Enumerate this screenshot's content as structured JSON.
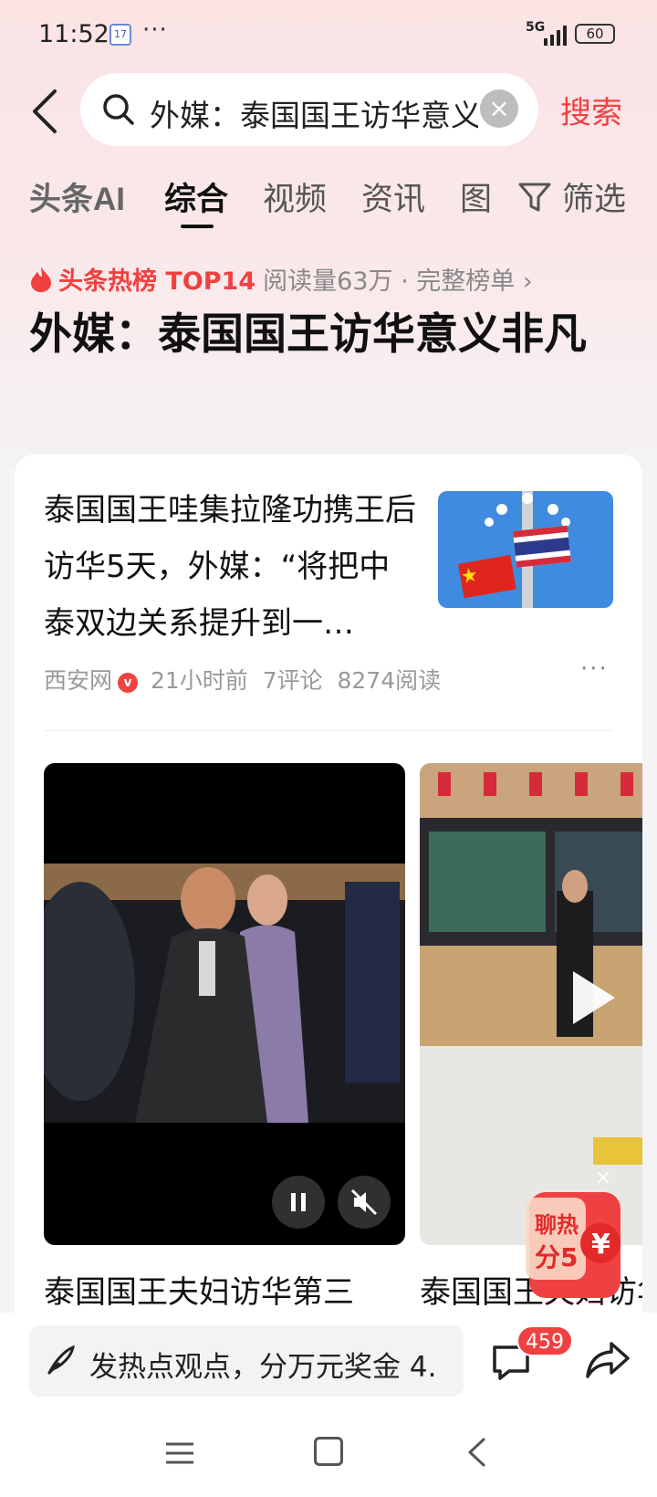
{
  "status_bar": {
    "time": "11:52",
    "cal_day": "17",
    "dots": "···",
    "network": "5G",
    "battery": "60"
  },
  "search": {
    "query": "外媒：泰国国王访华意义非凡",
    "clear_glyph": "×",
    "button": "搜索"
  },
  "tabs": [
    {
      "label": "头条AI"
    },
    {
      "label": "综合",
      "active": true
    },
    {
      "label": "视频"
    },
    {
      "label": "资讯"
    },
    {
      "label": "图"
    },
    {
      "label": "筛选"
    }
  ],
  "hot": {
    "label": "头条热榜 TOP14",
    "meta": "阅读量63万 · 完整榜单 ›",
    "title": "外媒：泰国国王访华意义非凡"
  },
  "article": {
    "title": "泰国国王哇集拉隆功携王后访华5天，外媒：“将把中泰双边关系提升到一…",
    "source": "西安网",
    "verify_glyph": "v",
    "time": "21小时前",
    "comments": "7评论",
    "reads": "8274阅读",
    "more": "···"
  },
  "videos": [
    {
      "title": "泰国国王夫妇访华第三"
    },
    {
      "title": "泰国国王夫妇访华后"
    }
  ],
  "promo": {
    "line1": "聊热",
    "line2": "分5",
    "currency": "¥",
    "close": "×"
  },
  "bottom": {
    "comment_placeholder": "发热点观点，分万元奖金 4.",
    "comment_count": "459"
  },
  "colors": {
    "accent": "#f04142",
    "text": "#111111",
    "muted": "#999999"
  }
}
